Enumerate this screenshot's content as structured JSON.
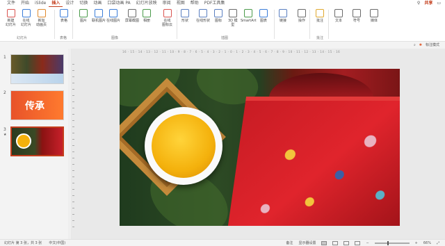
{
  "tabs": [
    "文件",
    "开始",
    "iSlide",
    "插入",
    "设计",
    "切换",
    "动画",
    "口袋动画 PA",
    "幻灯片放映",
    "审阅",
    "视图",
    "帮助",
    "PDF工具集"
  ],
  "active_tab": "插入",
  "share_label": "共享",
  "ribbon": {
    "buttons": [
      {
        "label": "新建\n幻灯片",
        "icon": "new-slide-icon"
      },
      {
        "label": "在线\n幻灯片",
        "icon": "online-slide-icon"
      },
      {
        "label": "新加\n动画页",
        "icon": "animation-page-icon"
      },
      {
        "label": "表格",
        "icon": "table-icon"
      },
      {
        "label": "图片",
        "icon": "picture-icon"
      },
      {
        "label": "联机图片",
        "icon": "online-picture-icon"
      },
      {
        "label": "在线图片",
        "icon": "web-picture-icon"
      },
      {
        "label": "屏幕截图",
        "icon": "screenshot-icon"
      },
      {
        "label": "相册",
        "icon": "album-icon"
      },
      {
        "label": "在线\n图标云",
        "icon": "icon-cloud-icon"
      },
      {
        "label": "形状",
        "icon": "shapes-icon"
      },
      {
        "label": "在线形状",
        "icon": "online-shapes-icon"
      },
      {
        "label": "图标",
        "icon": "icons-icon"
      },
      {
        "label": "3D 模\n型",
        "icon": "3d-model-icon"
      },
      {
        "label": "SmartArt",
        "icon": "smartart-icon"
      },
      {
        "label": "图表",
        "icon": "chart-icon"
      },
      {
        "label": "链接",
        "icon": "link-icon"
      },
      {
        "label": "操作",
        "icon": "action-icon"
      },
      {
        "label": "批注",
        "icon": "comment-icon"
      },
      {
        "label": "文本",
        "icon": "text-icon"
      },
      {
        "label": "符号",
        "icon": "symbol-icon"
      },
      {
        "label": "媒体",
        "icon": "media-icon"
      }
    ],
    "groups": [
      "幻灯片",
      "表格",
      "图像",
      "插图",
      "批注"
    ]
  },
  "subbar": {
    "label": "标注模式"
  },
  "slides": [
    {
      "number": "1"
    },
    {
      "number": "2",
      "text": "传承"
    },
    {
      "number": "3",
      "marker": "★"
    }
  ],
  "ruler_text": "16 · 15 · 14 · 13 · 12 · 11 · 10 · 9 · 8 · 7 · 6 · 5 · 4 · 3 · 2 · 1 · 0 · 1 · 2 · 3 · 4 · 5 · 6 · 7 · 8 · 9 · 10 · 11 · 12 · 13 · 14 · 15 · 16",
  "status": {
    "slide_info": "幻灯片 第 3 张，共 3 张",
    "language": "中文(中国)",
    "notes": "备注",
    "display_settings": "显示器设置",
    "zoom": "66%"
  }
}
